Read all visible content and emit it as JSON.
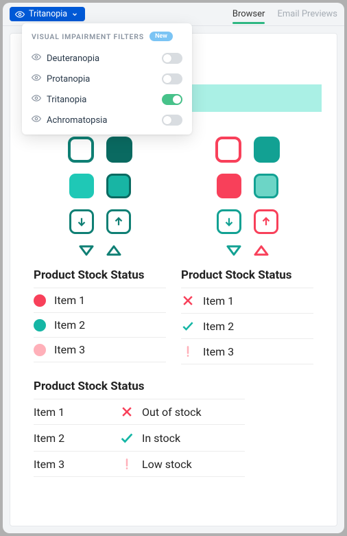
{
  "topbar": {
    "filter_label": "Tritanopia",
    "tabs": {
      "browser": "Browser",
      "email": "Email Previews",
      "active": "browser"
    }
  },
  "dropdown": {
    "title": "VISUAL IMPAIRMENT FILTERS",
    "new_label": "New",
    "items": [
      {
        "label": "Deuteranopia",
        "on": false
      },
      {
        "label": "Protanopia",
        "on": false
      },
      {
        "label": "Tritanopia",
        "on": true
      },
      {
        "label": "Achromatopsia",
        "on": false
      }
    ]
  },
  "colors": {
    "teal_dark": "#0f7f74",
    "teal_darker": "#075b53",
    "teal": "#1bc3b0",
    "teal_light": "#6cd5c6",
    "teal_band": "#aaf0e5",
    "red": "#f8405a",
    "red_light": "#f8405a",
    "pink": "#ffb0b9"
  },
  "left_col": {
    "heading": "Product Stock Status",
    "items": [
      {
        "label": "Item 1",
        "color": "#f8405a"
      },
      {
        "label": "Item 2",
        "color": "#15b6a5"
      },
      {
        "label": "Item 3",
        "color": "#ffb0b9"
      }
    ]
  },
  "right_col": {
    "heading": "Product Stock Status",
    "items": [
      {
        "label": "Item 1",
        "icon": "x",
        "color": "#f8405a"
      },
      {
        "label": "Item 2",
        "icon": "check",
        "color": "#15b6a5"
      },
      {
        "label": "Item 3",
        "icon": "bang",
        "color": "#ffb0b9"
      }
    ]
  },
  "wide": {
    "heading": "Product Stock Status",
    "rows": [
      {
        "item": "Item 1",
        "icon": "x",
        "color": "#f8405a",
        "status": "Out of stock"
      },
      {
        "item": "Item 2",
        "icon": "check",
        "color": "#15b6a5",
        "status": "In stock"
      },
      {
        "item": "Item 3",
        "icon": "bang",
        "color": "#ffb0b9",
        "status": "Low stock"
      }
    ]
  }
}
